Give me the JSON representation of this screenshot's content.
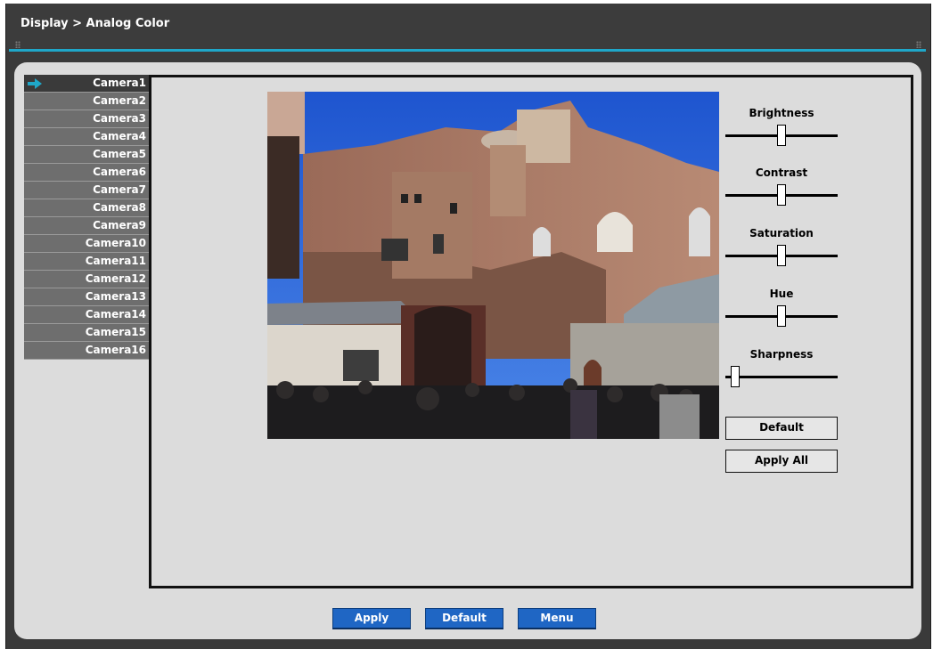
{
  "window": {
    "breadcrumb": "Display > Analog Color"
  },
  "colors": {
    "accent": "#1fa7c9",
    "button_blue": "#1f66c4",
    "camera_item": "#6e6e6e",
    "camera_active": "#3a3a3a"
  },
  "cameras": [
    {
      "label": "Camera1",
      "active": true
    },
    {
      "label": "Camera2",
      "active": false
    },
    {
      "label": "Camera3",
      "active": false
    },
    {
      "label": "Camera4",
      "active": false
    },
    {
      "label": "Camera5",
      "active": false
    },
    {
      "label": "Camera6",
      "active": false
    },
    {
      "label": "Camera7",
      "active": false
    },
    {
      "label": "Camera8",
      "active": false
    },
    {
      "label": "Camera9",
      "active": false
    },
    {
      "label": "Camera10",
      "active": false
    },
    {
      "label": "Camera11",
      "active": false
    },
    {
      "label": "Camera12",
      "active": false
    },
    {
      "label": "Camera13",
      "active": false
    },
    {
      "label": "Camera14",
      "active": false
    },
    {
      "label": "Camera15",
      "active": false
    },
    {
      "label": "Camera16",
      "active": false
    }
  ],
  "sliders": [
    {
      "label": "Brightness",
      "level": 0.5
    },
    {
      "label": "Contrast",
      "level": 0.5
    },
    {
      "label": "Saturation",
      "level": 0.5
    },
    {
      "label": "Hue",
      "level": 0.5
    },
    {
      "label": "Sharpness",
      "level": 0.0
    }
  ],
  "side_buttons": {
    "default_label": "Default",
    "apply_all_label": "Apply All"
  },
  "bottom_buttons": {
    "apply_label": "Apply",
    "default_label": "Default",
    "menu_label": "Menu"
  }
}
